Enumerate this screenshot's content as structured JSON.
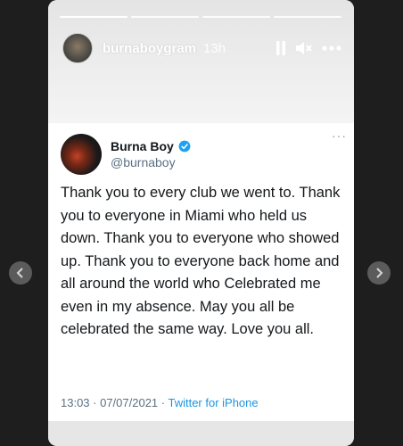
{
  "story": {
    "username": "burnaboygram",
    "time_ago": "13h",
    "progress": [
      {
        "fill": 1.0
      },
      {
        "fill": 0.0
      },
      {
        "fill": 0.0
      },
      {
        "fill": 0.0
      }
    ],
    "progress_active_index": 0
  },
  "tweet": {
    "name": "Burna Boy",
    "handle": "@burnaboy",
    "text": "Thank you to every club we went to. Thank you to everyone in Miami who held us down. Thank you to everyone who showed up. Thank you to everyone back home and all around the world who Celebrated me even in my absence. May you all be celebrated the same way. Love you all.",
    "timestamp": "13:03 · 07/07/2021 · ",
    "source": "Twitter for iPhone"
  },
  "icons": {
    "pause": "pause-icon",
    "mute": "speaker-muted-icon",
    "more": "more-horizontal-icon",
    "verified": "verified-badge-icon",
    "prev": "chevron-left-icon",
    "next": "chevron-right-icon"
  },
  "colors": {
    "twitter_blue": "#1b95e0",
    "verified_blue": "#1da1f2",
    "text_dark": "#14171a",
    "text_muted": "#5b7083"
  }
}
